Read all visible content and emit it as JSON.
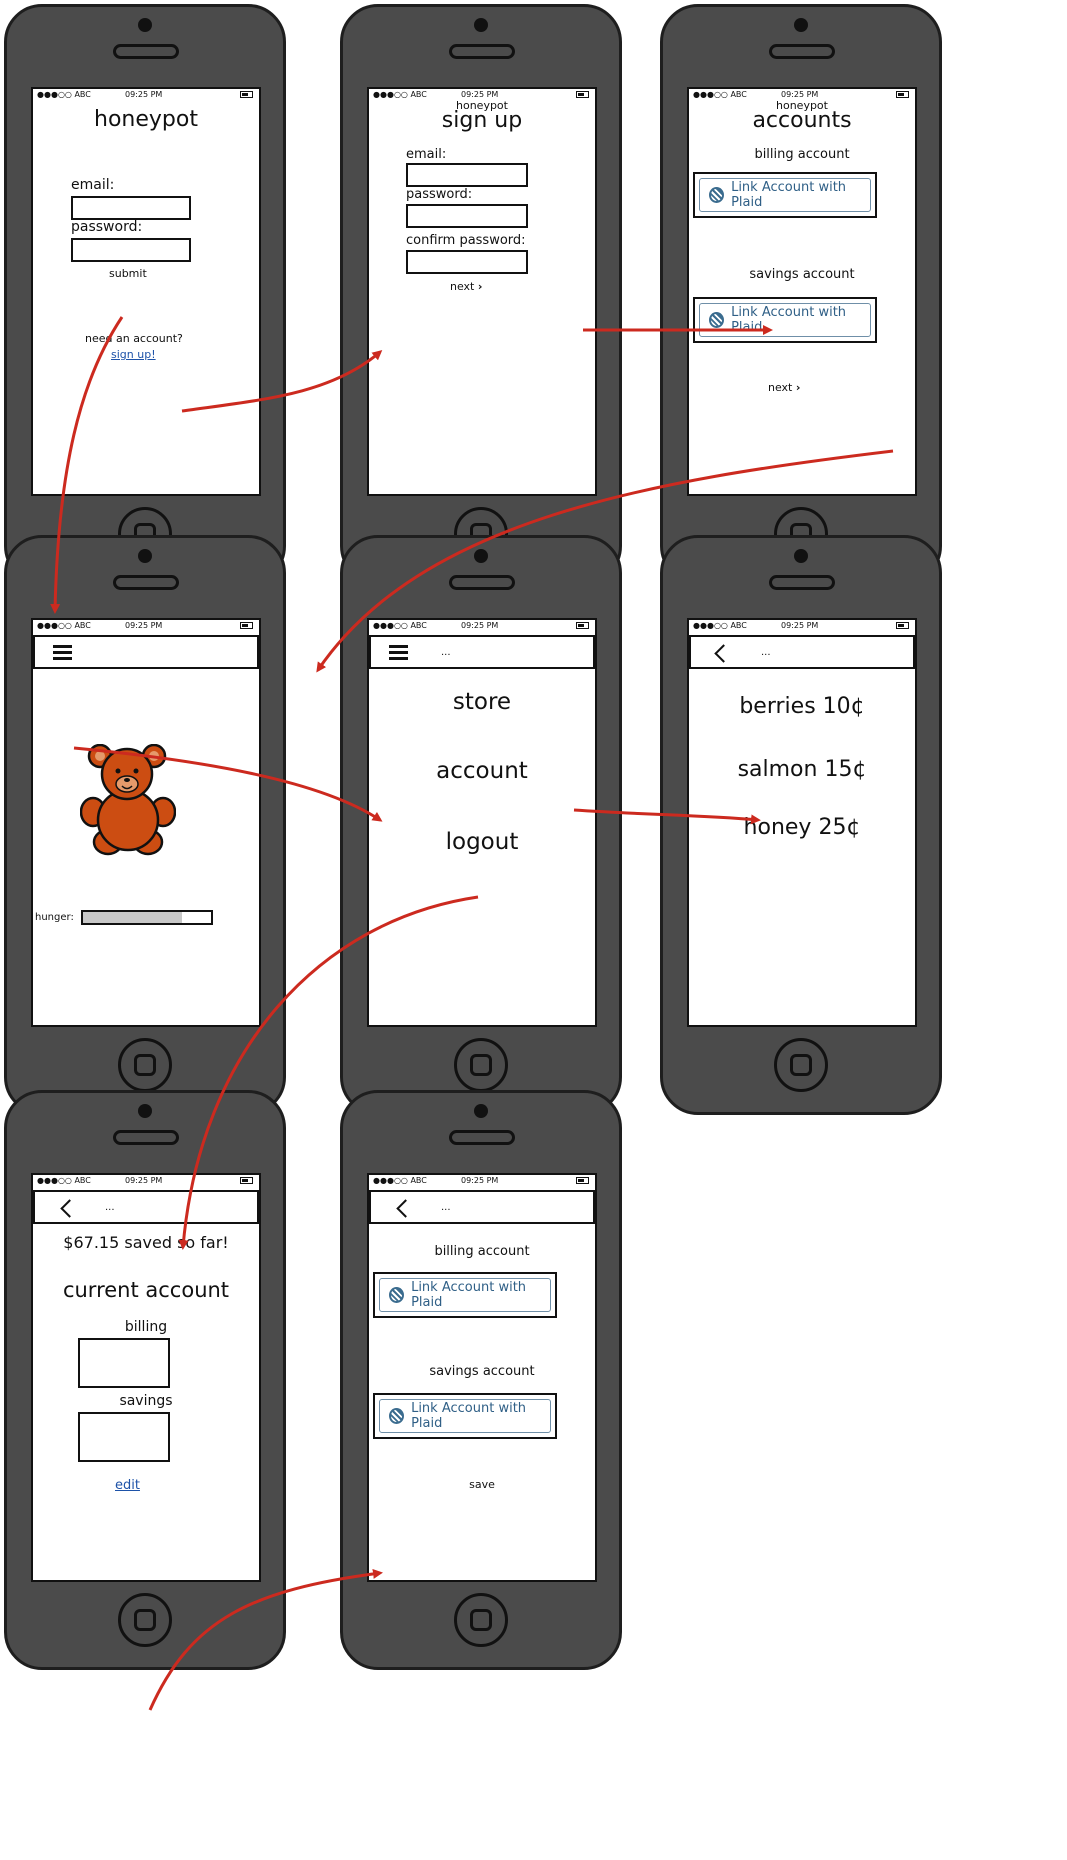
{
  "colors": {
    "arrow": "#cc2a1f",
    "phone_body": "#4b4b4b",
    "plaid": "#2f5f86",
    "link": "#1d52a8",
    "bear": "#cc4d12"
  },
  "status": {
    "signal": "●●●○○ ABC",
    "time": "09:25 PM"
  },
  "plaid_label": "Link Account with Plaid",
  "icons": {
    "plaid": "plaid-logo-icon",
    "menu": "hamburger-menu-icon",
    "back": "back-chevron-icon",
    "next": "next-chevron-icon",
    "bear": "teddy-bear-icon"
  },
  "login": {
    "title": "honeypot",
    "email_label": "email:",
    "password_label": "password:",
    "submit": "submit",
    "need_account": "need an account?",
    "signup_link": "sign up!"
  },
  "signup": {
    "brand": "honeypot",
    "title": "sign up",
    "email_label": "email:",
    "password_label": "password:",
    "confirm_label": "confirm password:",
    "next": "next"
  },
  "accounts": {
    "brand": "honeypot",
    "title": "accounts",
    "billing_label": "billing account",
    "savings_label": "savings account",
    "next": "next"
  },
  "home": {
    "hunger_label": "hunger:",
    "hunger_level": 0.77
  },
  "menu": {
    "title": "...",
    "items": [
      "store",
      "account",
      "logout"
    ]
  },
  "store": {
    "title": "...",
    "items": [
      "berries 10¢",
      "salmon 15¢",
      "honey 25¢"
    ]
  },
  "account_view": {
    "title": "...",
    "saved": "$67.15 saved so far!",
    "heading": "current account",
    "billing": "billing",
    "savings": "savings",
    "edit": "edit"
  },
  "edit_accounts": {
    "title": "...",
    "billing_label": "billing account",
    "savings_label": "savings account",
    "save": "save"
  }
}
